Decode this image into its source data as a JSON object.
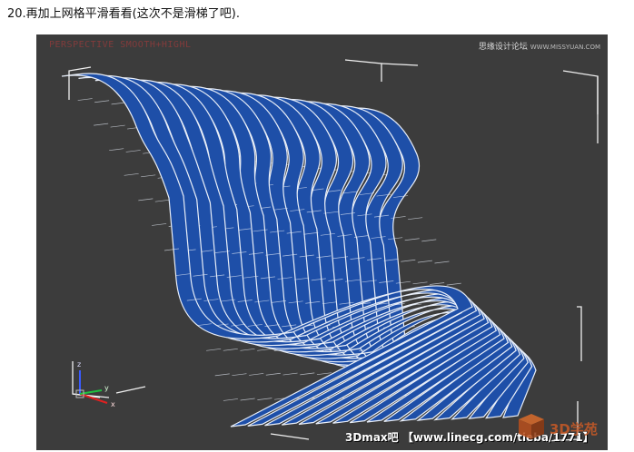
{
  "caption": "20.再加上网格平滑看看(这次不是滑梯了吧).",
  "viewport": {
    "label": "PERSPECTIVE SMOOTH+HIGHL",
    "background": "#3c3c3c",
    "mesh_color": "#1e4fa8",
    "mesh_line_color": "#e8eef8",
    "axis": {
      "z": "z",
      "x": "x",
      "y": "y"
    }
  },
  "watermarks": {
    "top_right_main": "思缘设计论坛",
    "top_right_url": "WWW.MISSYUAN.COM",
    "bottom": "3Dmax吧 【www.linecg.com/tieba/1771】",
    "logo_text": "3D学苑"
  }
}
